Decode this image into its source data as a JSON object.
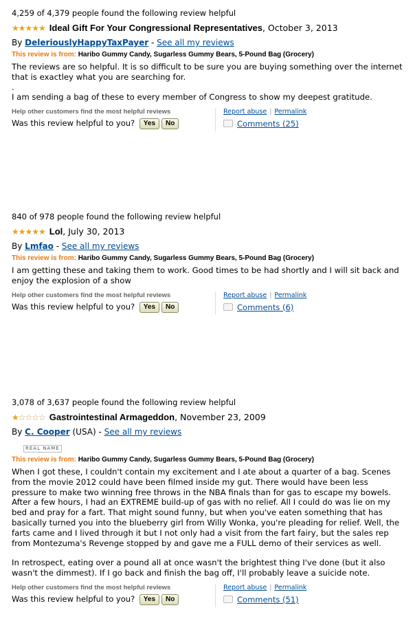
{
  "colors": {
    "link": "#004b91",
    "from_label": "#e47911",
    "star": "#e8a317"
  },
  "common": {
    "help_others": "Help other customers find the most helpful reviews",
    "was_helpful": "Was this review helpful to you?",
    "yes": "Yes",
    "no": "No",
    "report_abuse": "Report abuse",
    "permalink": "Permalink",
    "by": "By",
    "see_all": "See all my reviews",
    "from_label": "This review is from:",
    "product": "Haribo Gummy Candy, Sugarless Gummy Bears, 5-Pound Bag (Grocery)"
  },
  "reviews": [
    {
      "helpful_count": "4,259 of 4,379 people found the following review helpful",
      "rating": 5,
      "stars": "★★★★★",
      "stars_empty": "",
      "title": "Ideal Gift For Your Congressional Representatives",
      "date": ", October 3, 2013",
      "author": "DeleriouslyHappyTaxPayer",
      "body": [
        "The reviews are so helpful. It is so difficult to be sure you are buying something over the internet that is exactley what you are searching for.",
        ".",
        "I am sending a bag of these to every member of Congress to show my deepest gratitude."
      ],
      "comments": "Comments (25)"
    },
    {
      "helpful_count": "840 of 978 people found the following review helpful",
      "rating": 5,
      "stars": "★★★★★",
      "stars_empty": "",
      "title": "Lol",
      "date": ", July 30, 2013",
      "author": "Lmfao",
      "body": [
        "I am getting these and taking them to work. Good times to be had shortly and I will sit back and enjoy the explosion of a show"
      ],
      "comments": "Comments (6)"
    },
    {
      "helpful_count": "3,078 of 3,637 people found the following review helpful",
      "rating": 1,
      "stars": "★",
      "stars_empty": "☆☆☆☆",
      "title": "Gastrointestinal Armageddon",
      "date": ", November 23, 2009",
      "author": "C. Cooper",
      "author_location": "(USA)",
      "real_name_badge": "REAL NAME",
      "body": [
        "When I got these, I couldn't contain my excitement and I ate about a quarter of a bag. Scenes from the movie 2012 could have been filmed inside my gut. There would have been less pressure to make two winning free throws in the NBA finals than for gas to escape my bowels. After a few hours, I had an EXTREME build-up of gas with no relief. All I could do was lie on my bed and pray for a fart. That might sound funny, but when you've eaten something that has basically turned you into the blueberry girl from Willy Wonka, you're pleading for relief. Well, the farts came and I lived through it but I not only had a visit from the fart fairy, but the sales rep from Montezuma's Revenge stopped by and gave me a FULL demo of their services as well.",
        "In retrospect, eating over a pound all at once wasn't the brightest thing I've done (but it also wasn't the dimmest). If I go back and finish the bag off, I'll probably leave a suicide note."
      ],
      "comments": "Comments (51)"
    }
  ]
}
